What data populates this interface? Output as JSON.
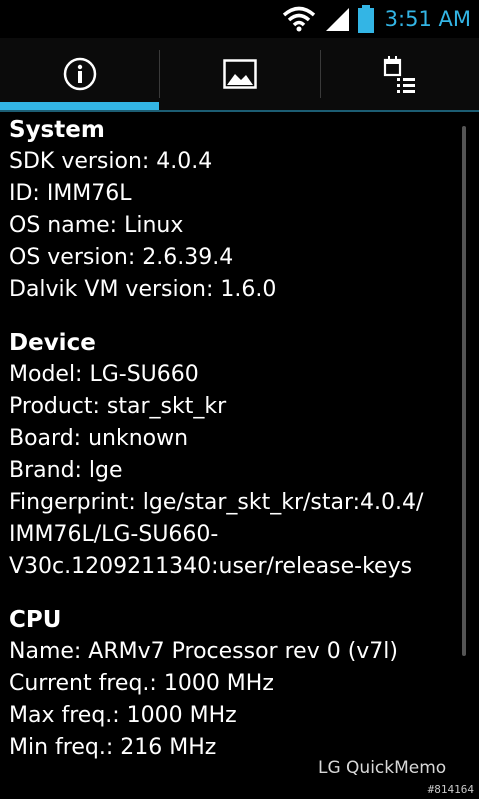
{
  "status_bar": {
    "time": "3:51 AM",
    "icons": [
      "wifi-icon",
      "signal-icon",
      "battery-icon"
    ]
  },
  "tabs": [
    {
      "icon": "info-icon",
      "selected": true
    },
    {
      "icon": "image-icon",
      "selected": false
    },
    {
      "icon": "calendar-list-icon",
      "selected": false
    }
  ],
  "sections": {
    "system": {
      "title": "System",
      "rows": [
        "SDK version: 4.0.4",
        "ID: IMM76L",
        "OS name: Linux",
        "OS version: 2.6.39.4",
        "Dalvik VM version: 1.6.0"
      ]
    },
    "device": {
      "title": "Device",
      "rows": [
        "Model: LG-SU660",
        "Product: star_skt_kr",
        "Board: unknown",
        "Brand: lge",
        "Fingerprint: lge/star_skt_kr/star:4.0.4/",
        "IMM76L/LG-SU660-",
        "V30c.1209211340:user/release-keys"
      ]
    },
    "cpu": {
      "title": "CPU",
      "rows": [
        "Name: ARMv7 Processor rev 0 (v7l)",
        "Current freq.: 1000 MHz",
        "Max freq.: 1000 MHz",
        "Min freq.: 216 MHz"
      ]
    }
  },
  "overlay": {
    "watermark": "LG QuickMemo",
    "tag": "#814164"
  },
  "colors": {
    "accent": "#33b5e5",
    "background": "#000000",
    "text": "#ffffff"
  }
}
